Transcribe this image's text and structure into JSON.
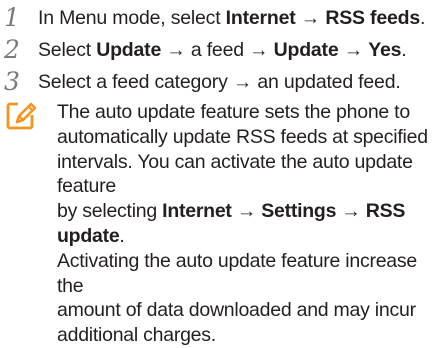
{
  "steps": [
    {
      "number": "1",
      "parts": [
        {
          "text": "In Menu mode, select ",
          "bold": false
        },
        {
          "text": "Internet",
          "bold": true
        },
        {
          "text": " → ",
          "bold": false
        },
        {
          "text": "RSS feeds",
          "bold": true
        },
        {
          "text": ".",
          "bold": false
        }
      ]
    },
    {
      "number": "2",
      "parts": [
        {
          "text": "Select ",
          "bold": false
        },
        {
          "text": "Update",
          "bold": true
        },
        {
          "text": " → a feed → ",
          "bold": false
        },
        {
          "text": "Update",
          "bold": true
        },
        {
          "text": " → ",
          "bold": false
        },
        {
          "text": "Yes",
          "bold": true
        },
        {
          "text": ".",
          "bold": false
        }
      ]
    },
    {
      "number": "3",
      "parts": [
        {
          "text": "Select a feed category → an updated feed.",
          "bold": false
        }
      ]
    }
  ],
  "note": {
    "icon": "note-pencil-icon",
    "accent_color": "#f7941d",
    "lines": [
      [
        {
          "text": "The auto update feature sets the phone to",
          "bold": false
        }
      ],
      [
        {
          "text": "automatically update RSS feeds at specified",
          "bold": false
        }
      ],
      [
        {
          "text": "intervals. You can activate the auto update feature",
          "bold": false
        }
      ],
      [
        {
          "text": "by selecting ",
          "bold": false
        },
        {
          "text": "Internet",
          "bold": true
        },
        {
          "text": " → ",
          "bold": false
        },
        {
          "text": "Settings",
          "bold": true
        },
        {
          "text": " → ",
          "bold": false
        },
        {
          "text": "RSS update",
          "bold": true
        },
        {
          "text": ".",
          "bold": false
        }
      ],
      [
        {
          "text": "Activating the auto update feature increase the",
          "bold": false
        }
      ],
      [
        {
          "text": "amount of data downloaded and may incur",
          "bold": false
        }
      ],
      [
        {
          "text": "additional charges.",
          "bold": false
        }
      ]
    ]
  }
}
